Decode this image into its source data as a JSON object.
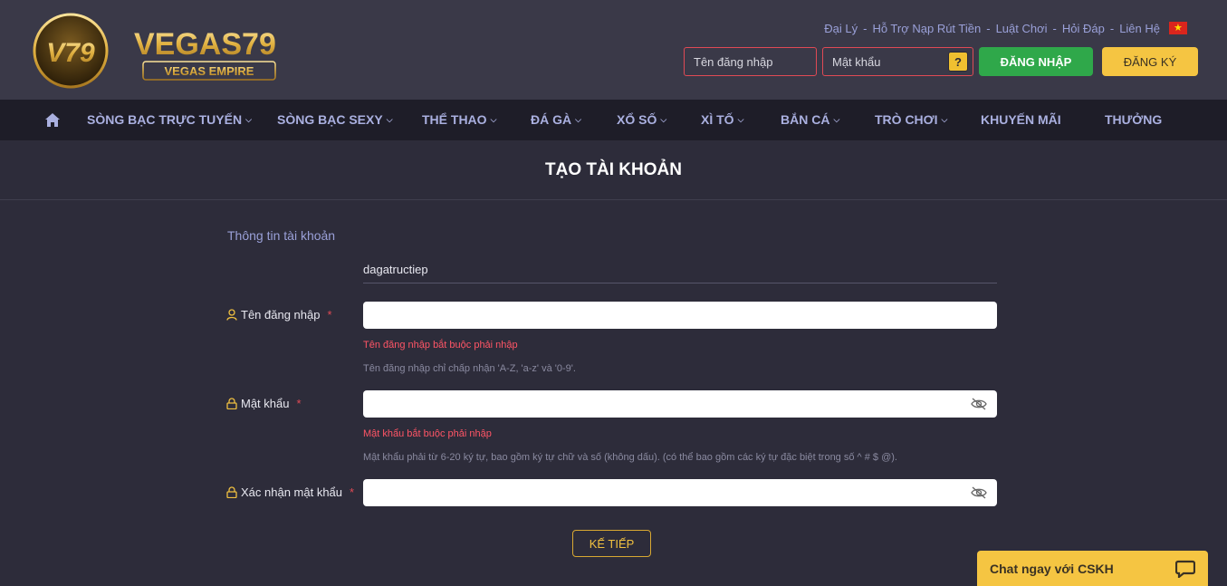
{
  "brand": {
    "name": "VEGAS79",
    "subtitle": "VEGAS EMPIRE",
    "monogram": "V79"
  },
  "top_links": [
    "Đại Lý",
    "Hỗ Trợ Nạp Rút Tiền",
    "Luật Chơi",
    "Hỏi Đáp",
    "Liên Hệ"
  ],
  "top_links_sep": "-",
  "login": {
    "username_placeholder": "Tên đăng nhập",
    "password_placeholder": "Mật khẩu",
    "help_label": "?",
    "login_label": "ĐĂNG NHẬP",
    "register_label": "ĐĂNG KÝ"
  },
  "nav": {
    "items": [
      {
        "label": "SÒNG BẠC TRỰC TUYẾN",
        "caret": "⌵"
      },
      {
        "label": "SÒNG BẠC SEXY",
        "caret": "⌵"
      },
      {
        "label": "THỂ THAO",
        "caret": "⌵"
      },
      {
        "label": "ĐÁ GÀ",
        "caret": "⌵"
      },
      {
        "label": "XỔ SỐ",
        "caret": "⌵"
      },
      {
        "label": "XÌ TỐ",
        "caret": "⌵"
      },
      {
        "label": "BẮN CÁ",
        "caret": "⌵"
      },
      {
        "label": "TRÒ CHƠI",
        "caret": "⌵"
      },
      {
        "label": "KHUYẾN MÃI",
        "caret": ""
      },
      {
        "label": "THƯỞNG",
        "caret": ""
      }
    ]
  },
  "page": {
    "title": "TẠO TÀI KHOẢN"
  },
  "form": {
    "section_label": "Thông tin tài khoản",
    "referral_value": "dagatructiep",
    "username": {
      "label": "Tên đăng nhập",
      "required_mark": "*",
      "value": "",
      "error": "Tên đăng nhập bắt buộc phải nhập",
      "hint": "Tên đăng nhập chỉ chấp nhận 'A-Z, 'a-z' và '0-9'."
    },
    "password": {
      "label": "Mật khẩu",
      "required_mark": "*",
      "value": "",
      "error": "Mật khẩu bắt buộc phải nhập",
      "hint": "Mật khẩu phải từ 6-20 ký tự, bao gồm ký tự chữ và số (không dấu). (có thể bao gồm các ký tự đặc biệt trong số ^ # $ @)."
    },
    "confirm_password": {
      "label": "Xác nhận mật khẩu",
      "required_mark": "*",
      "value": ""
    },
    "next_label": "KẾ TIẾP"
  },
  "chat": {
    "label": "Chat ngay với CSKH"
  },
  "colors": {
    "header_bg": "#3a3948",
    "nav_bg": "#1e1d28",
    "page_bg": "#2d2c3a",
    "accent_gold": "#f5c542",
    "login_green": "#2fa84a",
    "error_red": "#ff5566",
    "nav_text": "#aab0e0"
  },
  "icons": {
    "home": "home-icon",
    "user": "user-icon",
    "lock": "lock-icon",
    "eye_off": "eye-off-icon",
    "chat": "chat-bubble-icon",
    "flag": "vietnam-flag-icon"
  }
}
